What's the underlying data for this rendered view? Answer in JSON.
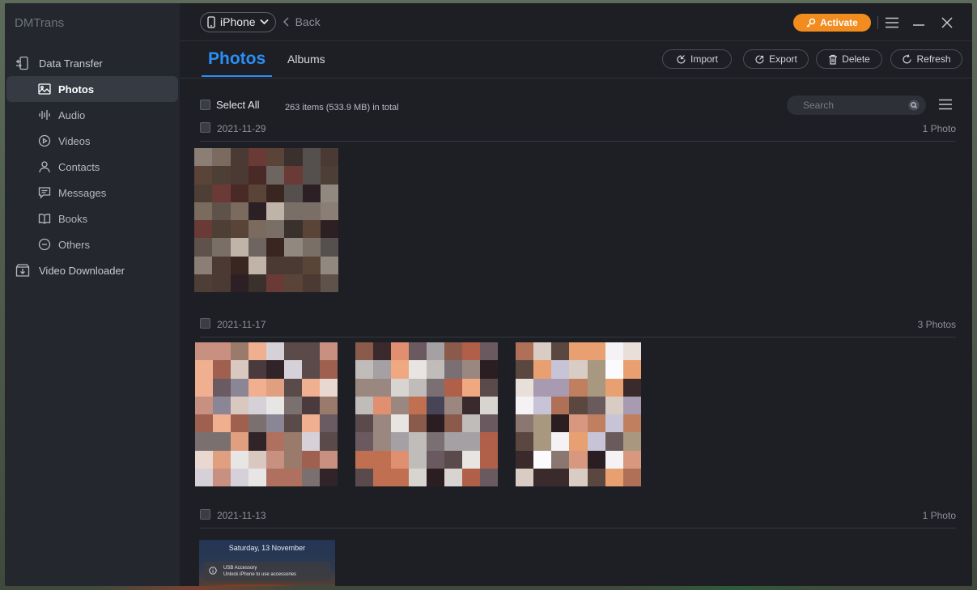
{
  "app": {
    "name": "DMTrans"
  },
  "sidebar": {
    "sections": [
      {
        "label": "Data Transfer",
        "icon": "phone-transfer-icon"
      },
      {
        "label": "Video Downloader",
        "icon": "download-icon"
      }
    ],
    "items": [
      {
        "label": "Photos",
        "icon": "image-icon",
        "active": true
      },
      {
        "label": "Audio",
        "icon": "waveform-icon"
      },
      {
        "label": "Videos",
        "icon": "play-circle-icon"
      },
      {
        "label": "Contacts",
        "icon": "person-icon"
      },
      {
        "label": "Messages",
        "icon": "message-icon"
      },
      {
        "label": "Books",
        "icon": "book-icon"
      },
      {
        "label": "Others",
        "icon": "more-circle-icon"
      }
    ]
  },
  "titlebar": {
    "device": "iPhone",
    "back_label": "Back",
    "activate_label": "Activate"
  },
  "tabs": {
    "photos": "Photos",
    "albums": "Albums"
  },
  "toolbar": {
    "import_label": "Import",
    "export_label": "Export",
    "delete_label": "Delete",
    "refresh_label": "Refresh"
  },
  "listbar": {
    "select_all_label": "Select All",
    "summary": "263 items (533.9 MB) in total",
    "search_placeholder": "Search"
  },
  "groups": [
    {
      "date": "2021-11-29",
      "count": "1 Photo"
    },
    {
      "date": "2021-11-17",
      "count": "3 Photos"
    },
    {
      "date": "2021-11-13",
      "count": "1 Photo"
    }
  ],
  "lockscreen": {
    "date": "Saturday, 13 November",
    "notif_title": "USB Accessory",
    "notif_body": "Unlock iPhone to use accessories"
  },
  "colors": {
    "accent": "#2b8ef5",
    "activate": "#f28c1e",
    "sidebar_bg": "#24272d",
    "main_bg": "#1d1f24"
  }
}
